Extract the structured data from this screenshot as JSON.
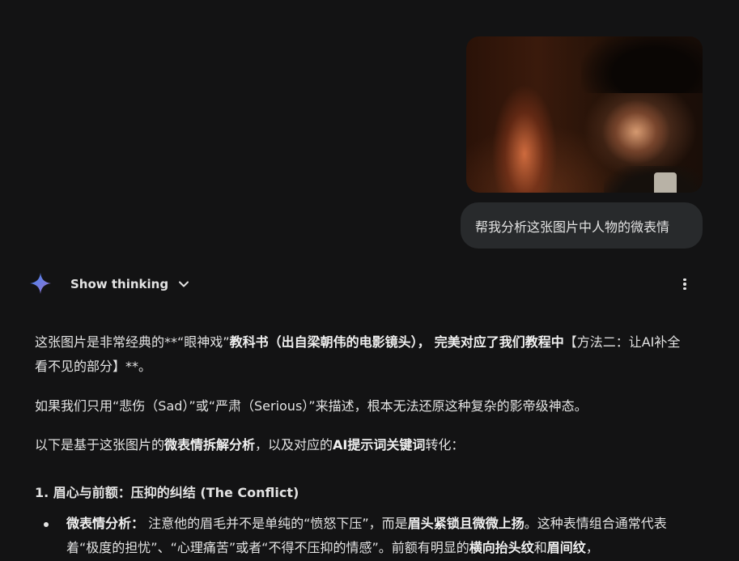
{
  "user_message": {
    "image_alt": "人物面部特写剧照",
    "text": "帮我分析这张图片中人物的微表情"
  },
  "assistant": {
    "show_thinking_label": "Show thinking",
    "spark_icon": "gemini-spark-icon",
    "spark_colors": [
      "#4285f4",
      "#9b72cb"
    ],
    "menu_icon": "more-vert-icon"
  },
  "response": {
    "p1": {
      "t1": "这张图片是非常经典的**“眼神戏”",
      "b1": "教科书（出自梁朝伟的电影镜头），",
      "t2": " ",
      "b2": "完美对应了我们教程中",
      "t3": "【方法二：让AI补全看不见的部分】**。"
    },
    "p2": "如果我们只用“悲伤（Sad）”或“严肃（Serious）”来描述，根本无法还原这种复杂的影帝级神态。",
    "p3": {
      "t1": "以下是基于这张图片的",
      "b1": "微表情拆解分析",
      "t2": "，以及对应的",
      "b2": "AI提示词关键词",
      "t3": "转化："
    },
    "section1_heading": "1. 眉心与前额：压抑的纠结 (The Conflict)",
    "bullet1": {
      "b1": "微表情分析：",
      "t1": " 注意他的眉毛并不是单纯的“愤怒下压”，而是",
      "b2": "眉头紧锁且微微上扬",
      "t2": "。这种表情组合通常代表着“极度的担忧”、“心理痛苦”或者“不得不压抑的情感”。前额有明显的",
      "b3": "横向抬头纹",
      "t3": "和",
      "b4": "眉间纹",
      "t4": "，"
    }
  }
}
